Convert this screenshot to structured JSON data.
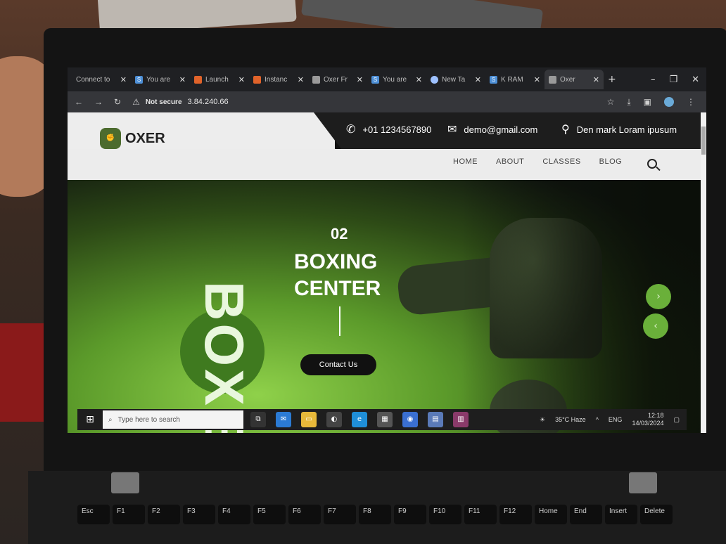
{
  "browser": {
    "tabs": [
      {
        "label": "Connect to",
        "icon": "none"
      },
      {
        "label": "You are",
        "icon": "s"
      },
      {
        "label": "Launch",
        "icon": "orange"
      },
      {
        "label": "Instanc",
        "icon": "orange"
      },
      {
        "label": "Oxer Fr",
        "icon": "grey"
      },
      {
        "label": "You are",
        "icon": "s"
      },
      {
        "label": "New Ta",
        "icon": "chrome"
      },
      {
        "label": "K RAM",
        "icon": "s"
      },
      {
        "label": "Oxer",
        "icon": "grey",
        "active": true
      }
    ],
    "security_label": "Not secure",
    "url": "3.84.240.66"
  },
  "site": {
    "logo_text": "OXER",
    "phone": "+01 1234567890",
    "email": "demo@gmail.com",
    "location": "Den mark Loram ipusum",
    "nav": [
      "HOME",
      "ABOUT",
      "CLASSES",
      "BLOG"
    ]
  },
  "hero": {
    "vertical_text": "BOXER",
    "slide_number": "02",
    "headline_line1": "BOXING",
    "headline_line2": "CENTER",
    "cta_label": "Contact Us",
    "next_arrow": "›",
    "prev_arrow": "‹"
  },
  "taskbar": {
    "search_placeholder": "Type here to search",
    "weather": "35°C  Haze",
    "language": "ENG",
    "time": "12:18",
    "date": "14/03/2024"
  },
  "keyboard": {
    "keys": [
      "Esc",
      "F1",
      "F2",
      "F3",
      "F4",
      "F5",
      "F6",
      "F7",
      "F8",
      "F9",
      "F10",
      "F11",
      "F12",
      "Home",
      "End",
      "Insert",
      "Delete"
    ]
  },
  "colors": {
    "accent_green": "#6ab03a",
    "hero_glow": "#8fd14a"
  }
}
